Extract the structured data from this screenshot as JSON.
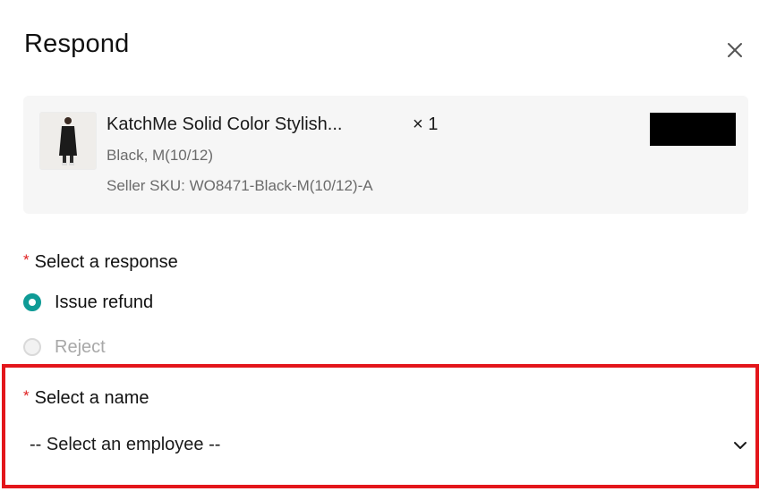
{
  "dialog": {
    "title": "Respond",
    "close_icon": "close-icon"
  },
  "product": {
    "name": "KatchMe Solid Color Stylish...",
    "quantity": "× 1",
    "variant": "Black, M(10/12)",
    "sku": "Seller SKU: WO8471-Black-M(10/12)-A",
    "price_redacted": true
  },
  "response_section": {
    "required_mark": "*",
    "label": "Select a response",
    "options": [
      {
        "label": "Issue refund",
        "selected": true,
        "enabled": true
      },
      {
        "label": "Reject",
        "selected": false,
        "enabled": false
      }
    ]
  },
  "name_section": {
    "required_mark": "*",
    "label": "Select a name",
    "select_value": "-- Select an employee --",
    "chevron_icon": "chevron-down-icon"
  },
  "colors": {
    "accent": "#0f9b96",
    "required": "#e02020",
    "highlight_border": "#e3161b"
  }
}
